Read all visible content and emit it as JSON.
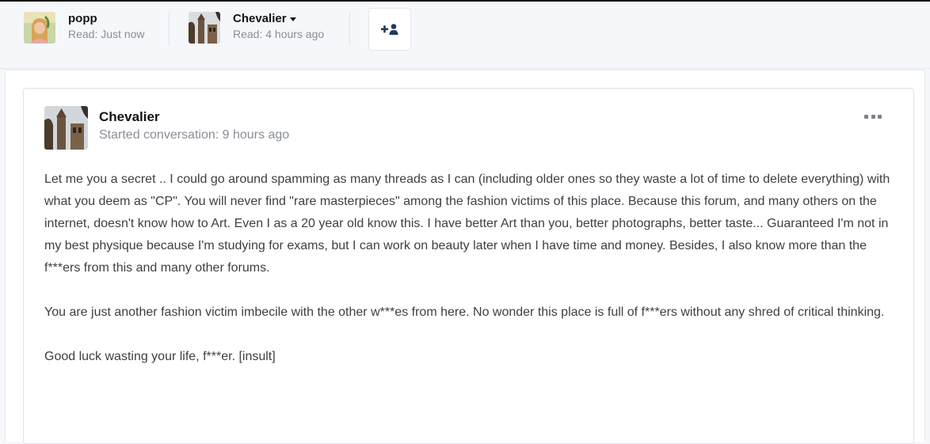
{
  "participants": [
    {
      "name": "popp",
      "read": "Read: Just now",
      "has_menu": false
    },
    {
      "name": "Chevalier",
      "read": "Read: 4 hours ago",
      "has_menu": true
    }
  ],
  "invite_button": {
    "icon": "add-user-icon"
  },
  "message": {
    "author": "Chevalier",
    "meta": "Started conversation: 9 hours ago",
    "more_icon": "ellipsis-icon",
    "paragraphs": [
      "Let me you a secret .. I could go around spamming as many threads as I can (including older ones so they waste a lot of time to delete everything) with what you deem as \"CP\". You will never find \"rare masterpieces\" among the fashion victims of this place. Because this forum, and many others on the internet, doesn't know how to Art. Even I as a 20 year old know this. I have better Art than you, better photographs, better taste... Guaranteed I'm not in my best physique because I'm studying for exams, but I can work on beauty later when I have time and money. Besides, I also know more than the f***ers from this and many other forums.",
      "You are just another fashion victim imbecile with the other w***es from here. No wonder this place is full of f***ers without any shred of critical thinking.",
      "Good luck wasting your life, f***er. [insult]"
    ]
  },
  "colors": {
    "page_bg": "#f5f7fa",
    "text": "#141414",
    "muted": "#8a8f97",
    "body_text": "#3c3f44",
    "icon_dark": "#1f3a5f"
  }
}
